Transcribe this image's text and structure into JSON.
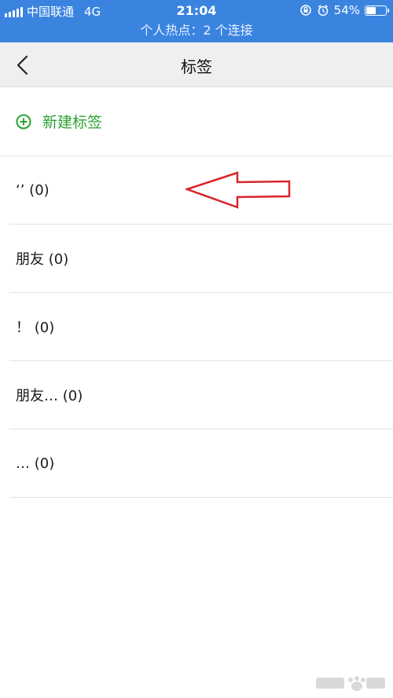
{
  "status_bar": {
    "carrier": "中国联通",
    "network": "4G",
    "time": "21:04",
    "battery": "54%",
    "battery_level": 0.54
  },
  "hotspot": {
    "text": "个人热点：2 个连接"
  },
  "nav": {
    "title": "标签",
    "back_icon": "chevron-left-icon"
  },
  "new_tag": {
    "label": "新建标签",
    "icon": "plus-circle-icon"
  },
  "tags": [
    {
      "label": "‘’ (0)"
    },
    {
      "label": "朋友 (0)"
    },
    {
      "label": "！ (0)"
    },
    {
      "label": "朋友… (0)"
    },
    {
      "label": "… (0)"
    }
  ],
  "colors": {
    "status_bar": "#3a84e0",
    "accent_green": "#2aa332",
    "arrow_red": "#d9252a"
  }
}
